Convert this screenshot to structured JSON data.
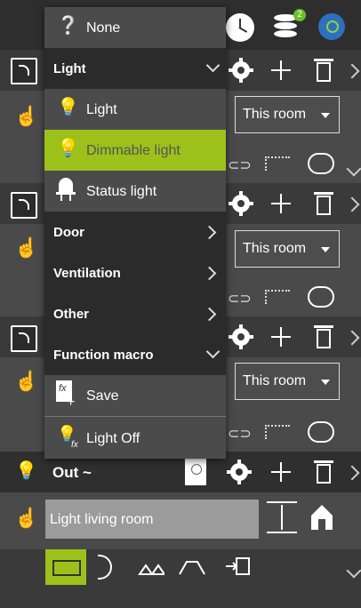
{
  "topbar": {
    "notification_count": "2"
  },
  "rooms": [
    {
      "select_value": "This room"
    },
    {
      "select_value": "This room"
    },
    {
      "select_value": "This room"
    }
  ],
  "out_row": {
    "label": "Out ~"
  },
  "bottom": {
    "name_value": "Light living room"
  },
  "menu": {
    "none_label": "None",
    "light_group_label": "Light",
    "light_label": "Light",
    "dimmable_label": "Dimmable light",
    "status_label": "Status light",
    "door_label": "Door",
    "ventilation_label": "Ventilation",
    "other_label": "Other",
    "function_macro_label": "Function macro",
    "save_label": "Save",
    "light_off_label": "Light Off"
  },
  "colors": {
    "accent": "#9cc11a",
    "menu_bg": "#2b2b2b",
    "menu_item_bg": "#4b4b4b",
    "badge": "#6abf2a"
  }
}
